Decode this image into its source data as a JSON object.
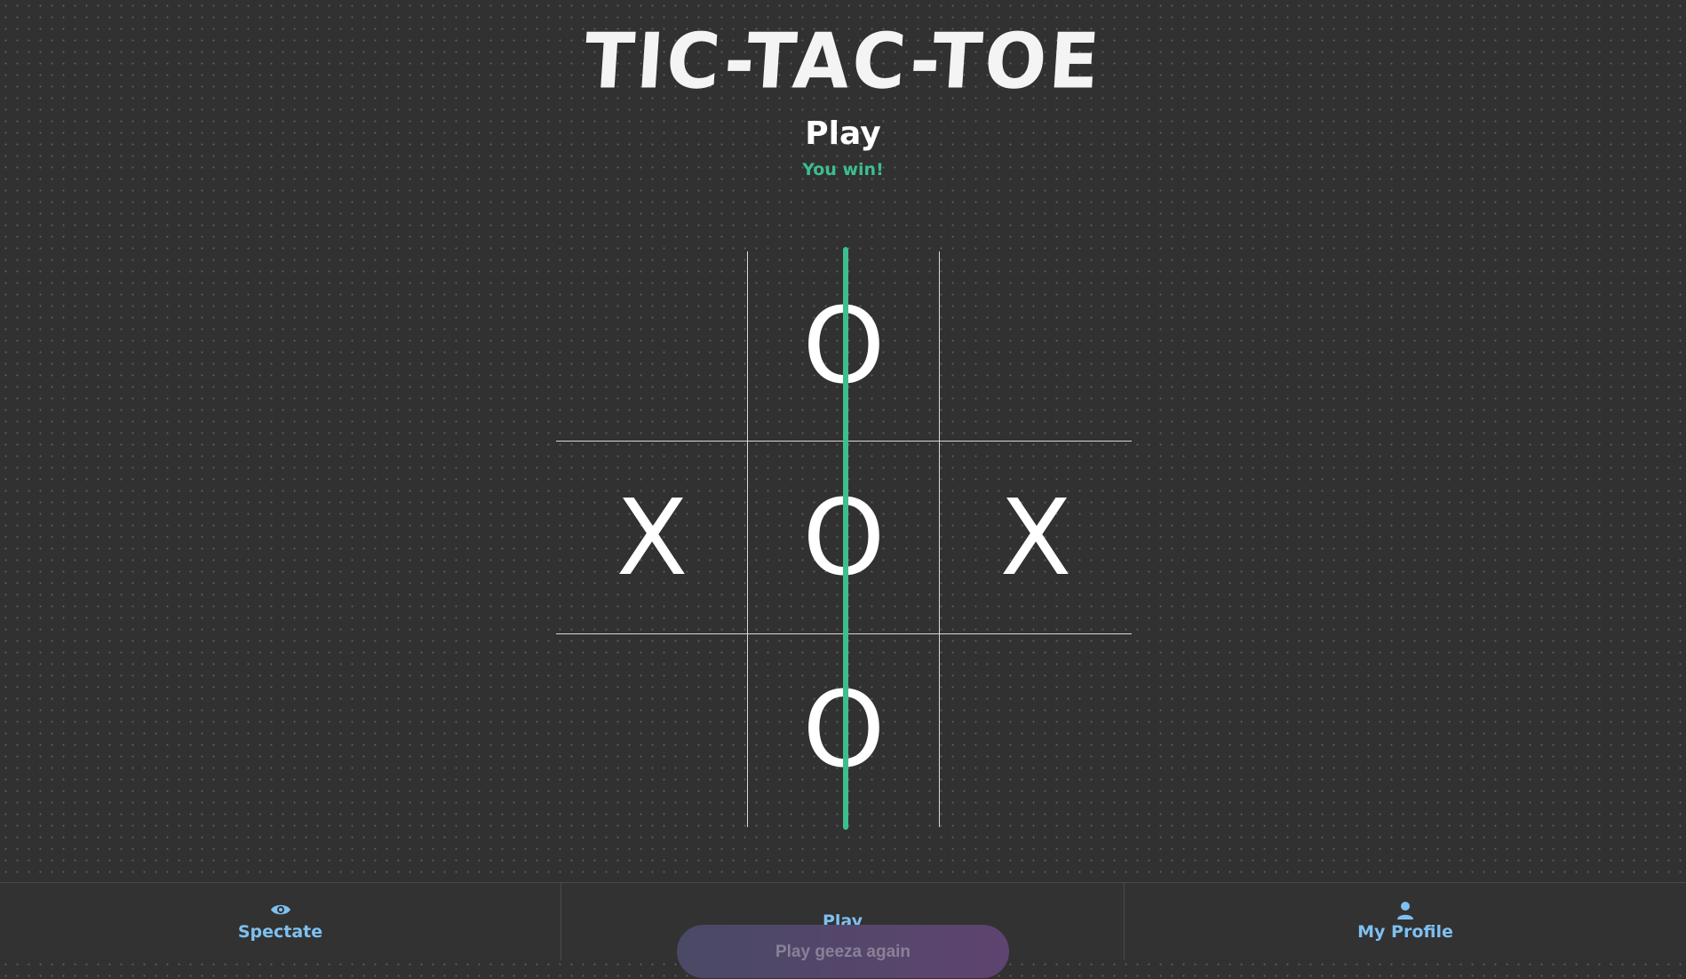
{
  "header": {
    "title": "TIC-TAC-TOE",
    "subtitle": "Play",
    "status": "You win!"
  },
  "board": {
    "cells": [
      "",
      "O",
      "",
      "X",
      "O",
      "X",
      "",
      "O",
      ""
    ],
    "winning_line": "middle-column"
  },
  "colors": {
    "background": "#313131",
    "accent": "#3cbf8f",
    "nav_text": "#7fc0f0"
  },
  "play_again_label": "Play geeza again",
  "nav": {
    "spectate": {
      "label": "Spectate",
      "icon": "eye-icon"
    },
    "play": {
      "label": "Play"
    },
    "profile": {
      "label": "My Profile",
      "icon": "user-icon"
    }
  }
}
